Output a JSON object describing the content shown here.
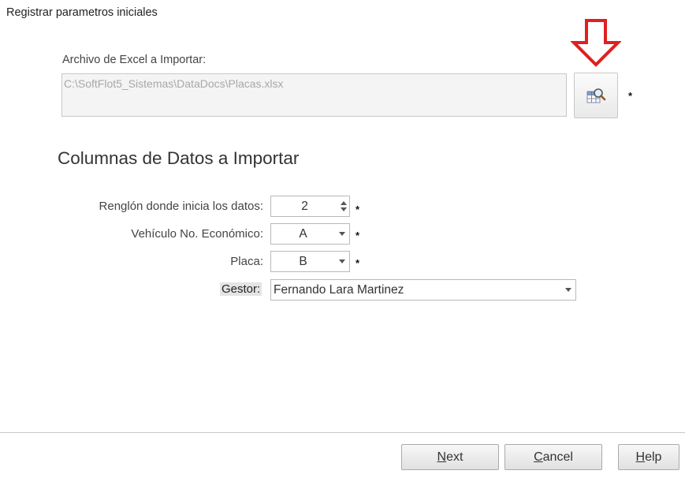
{
  "window": {
    "title": "Registrar parametros iniciales"
  },
  "file": {
    "label": "Archivo de Excel a Importar:",
    "path": "C:\\SoftFlot5_Sistemas\\DataDocs\\Placas.xlsx",
    "browse_icon": "spreadsheet-search-icon",
    "required_mark": "*"
  },
  "annotation": {
    "icon": "red-down-arrow",
    "color": "#e02020"
  },
  "section": {
    "title": "Columnas de Datos a Importar"
  },
  "fields": {
    "start_row": {
      "label": "Renglón donde inicia los datos:",
      "value": "2",
      "required_mark": "*"
    },
    "vehicle": {
      "label": "Vehículo No. Económico:",
      "value": "A",
      "required_mark": "*"
    },
    "plate": {
      "label": "Placa:",
      "value": "B",
      "required_mark": "*"
    },
    "manager": {
      "label": "Gestor:",
      "value": "Fernando Lara Martinez"
    }
  },
  "buttons": {
    "next": {
      "mnemonic": "N",
      "rest": "ext"
    },
    "cancel": {
      "mnemonic": "C",
      "rest": "ancel"
    },
    "help": {
      "mnemonic": "H",
      "rest": "elp"
    }
  }
}
